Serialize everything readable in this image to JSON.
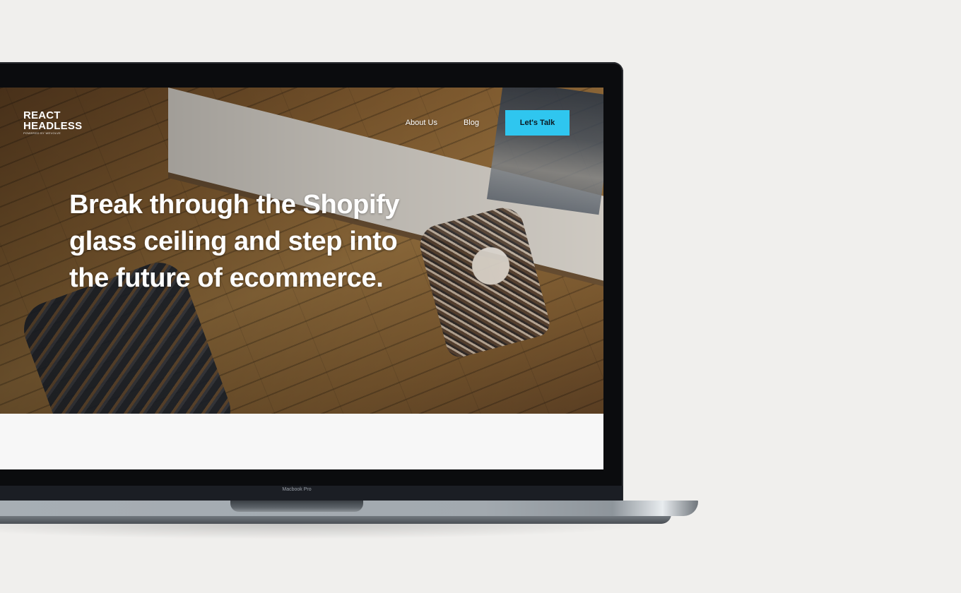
{
  "site": {
    "logo_line1": "REACT",
    "logo_line2": "HEADLESS",
    "logo_tagline": "POWERED BY WEVOLVE"
  },
  "nav": {
    "items": [
      {
        "label": "About Us"
      },
      {
        "label": "Blog"
      }
    ],
    "cta_label": "Let's Talk"
  },
  "hero": {
    "headline": "Break through the Shopify glass ceiling and step into the future of ecommerce."
  },
  "device": {
    "model_label": "Macbook Pro"
  },
  "colors": {
    "cta": "#2fc6ef",
    "background": "#f0efed",
    "bezel": "#0b0c0e"
  }
}
